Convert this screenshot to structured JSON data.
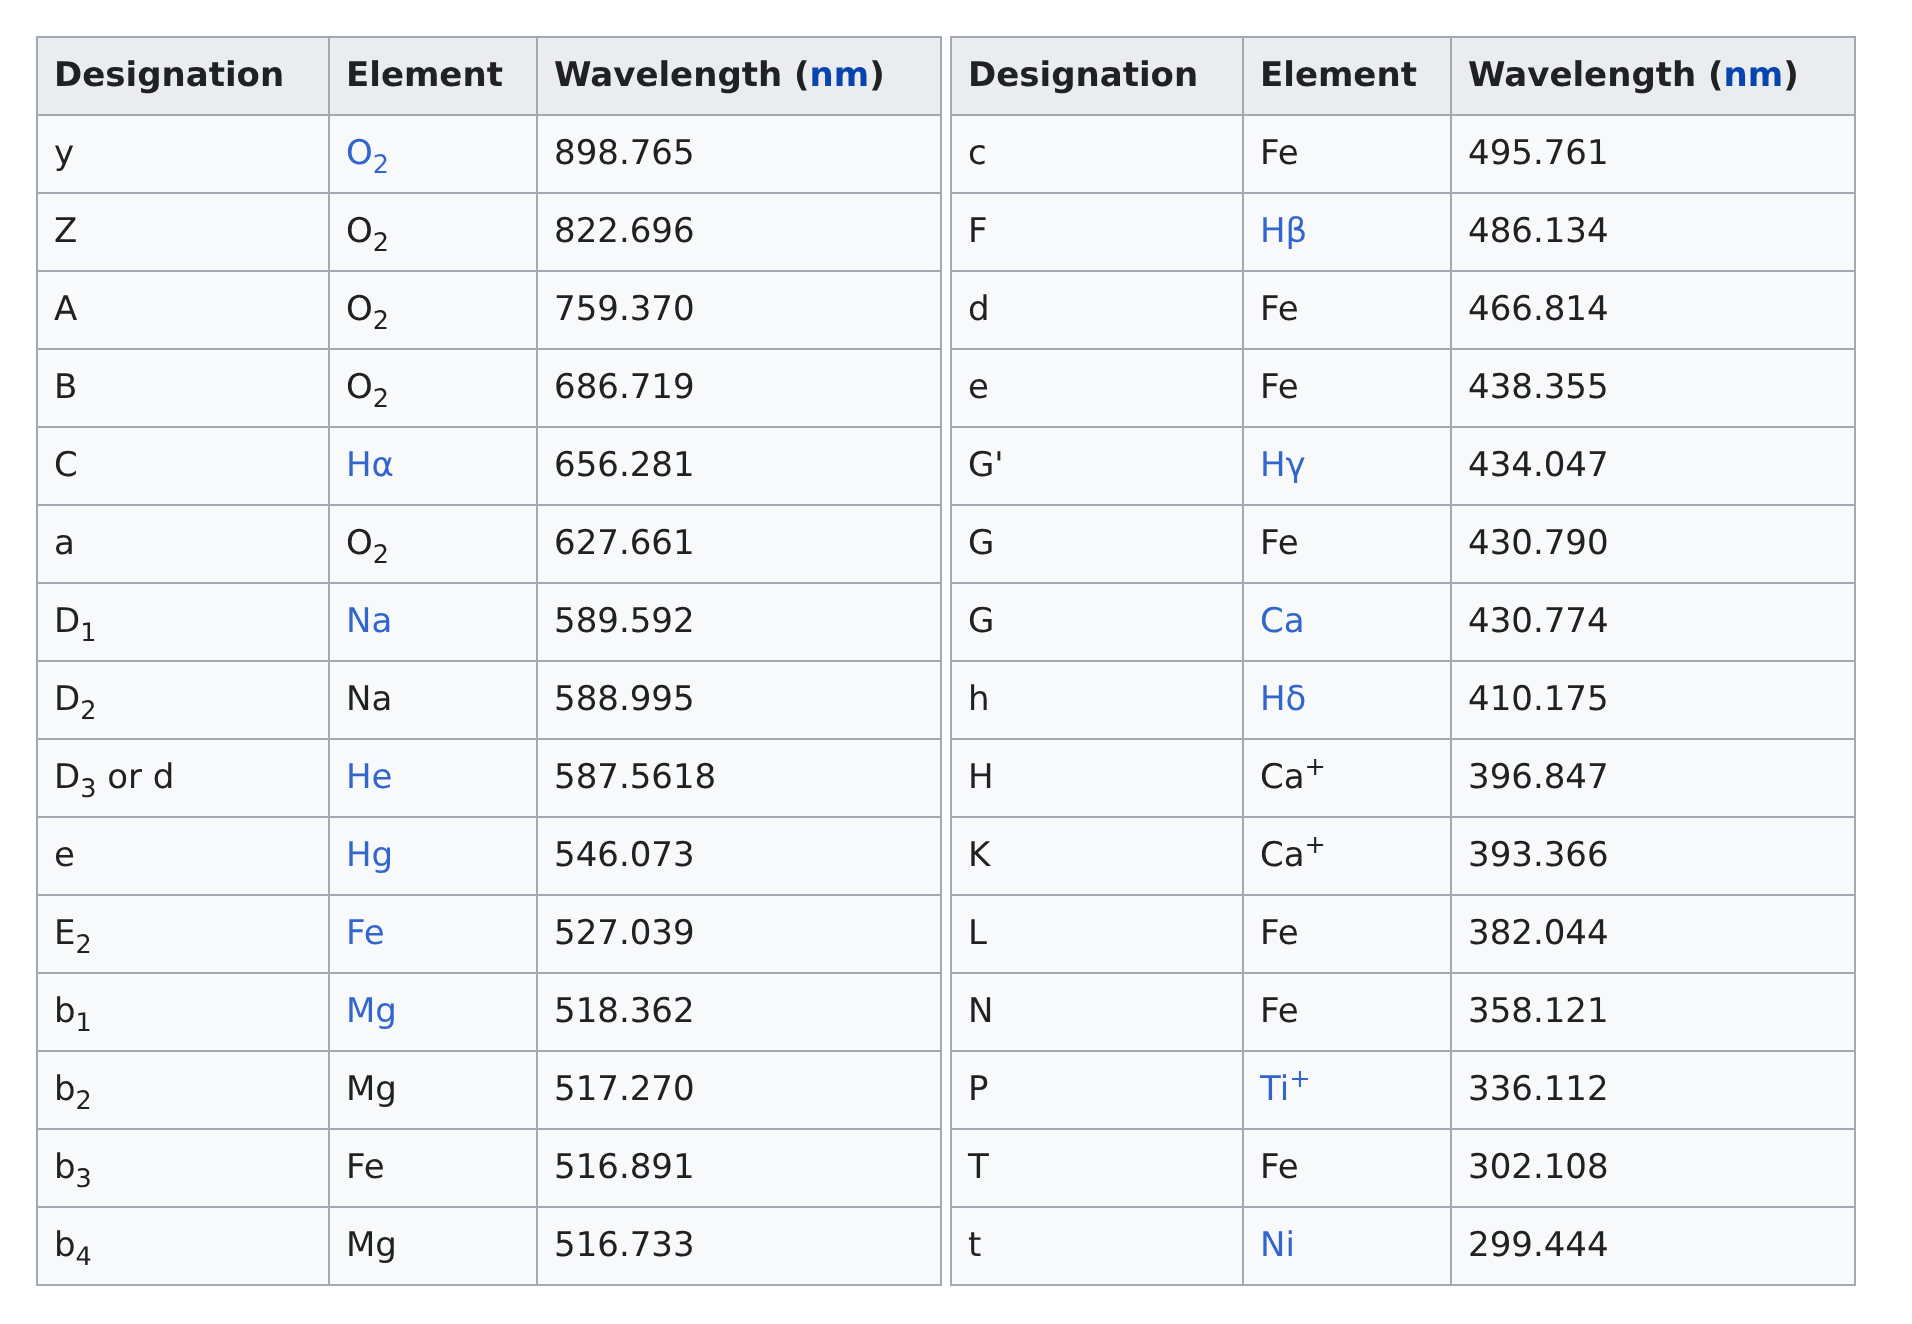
{
  "tables": [
    {
      "columns": [
        {
          "label": "Designation"
        },
        {
          "label": "Element"
        },
        {
          "label": "Wavelength (",
          "link": "nm",
          "suffix": ")"
        }
      ],
      "rows": [
        {
          "designation": "y",
          "element": "O$_{2}$",
          "element_linked": true,
          "wavelength": "898.765"
        },
        {
          "designation": "Z",
          "element": "O$_{2}$",
          "element_linked": false,
          "wavelength": "822.696"
        },
        {
          "designation": "A",
          "element": "O$_{2}$",
          "element_linked": false,
          "wavelength": "759.370"
        },
        {
          "designation": "B",
          "element": "O$_{2}$",
          "element_linked": false,
          "wavelength": "686.719"
        },
        {
          "designation": "C",
          "element": "Hα",
          "element_linked": true,
          "wavelength": "656.281"
        },
        {
          "designation": "a",
          "element": "O$_{2}$",
          "element_linked": false,
          "wavelength": "627.661"
        },
        {
          "designation": "D$_{1}$",
          "element": "Na",
          "element_linked": true,
          "wavelength": "589.592"
        },
        {
          "designation": "D$_{2}$",
          "element": "Na",
          "element_linked": false,
          "wavelength": "588.995"
        },
        {
          "designation": "D$_{3}$ or d",
          "element": "He",
          "element_linked": true,
          "wavelength": "587.5618"
        },
        {
          "designation": "e",
          "element": "Hg",
          "element_linked": true,
          "wavelength": "546.073"
        },
        {
          "designation": "E$_{2}$",
          "element": "Fe",
          "element_linked": true,
          "wavelength": "527.039"
        },
        {
          "designation": "b$_{1}$",
          "element": "Mg",
          "element_linked": true,
          "wavelength": "518.362"
        },
        {
          "designation": "b$_{2}$",
          "element": "Mg",
          "element_linked": false,
          "wavelength": "517.270"
        },
        {
          "designation": "b$_{3}$",
          "element": "Fe",
          "element_linked": false,
          "wavelength": "516.891"
        },
        {
          "designation": "b$_{4}$",
          "element": "Mg",
          "element_linked": false,
          "wavelength": "516.733"
        }
      ]
    },
    {
      "columns": [
        {
          "label": "Designation"
        },
        {
          "label": "Element"
        },
        {
          "label": "Wavelength (",
          "link": "nm",
          "suffix": ")"
        }
      ],
      "rows": [
        {
          "designation": "c",
          "element": "Fe",
          "element_linked": false,
          "wavelength": "495.761"
        },
        {
          "designation": "F",
          "element": "Hβ",
          "element_linked": true,
          "wavelength": "486.134"
        },
        {
          "designation": "d",
          "element": "Fe",
          "element_linked": false,
          "wavelength": "466.814"
        },
        {
          "designation": "e",
          "element": "Fe",
          "element_linked": false,
          "wavelength": "438.355"
        },
        {
          "designation": "G'",
          "element": "Hγ",
          "element_linked": true,
          "wavelength": "434.047"
        },
        {
          "designation": "G",
          "element": "Fe",
          "element_linked": false,
          "wavelength": "430.790"
        },
        {
          "designation": "G",
          "element": "Ca",
          "element_linked": true,
          "wavelength": "430.774"
        },
        {
          "designation": "h",
          "element": "Hδ",
          "element_linked": true,
          "wavelength": "410.175"
        },
        {
          "designation": "H",
          "element": "Ca$^{+}$",
          "element_linked": false,
          "wavelength": "396.847"
        },
        {
          "designation": "K",
          "element": "Ca$^{+}$",
          "element_linked": false,
          "wavelength": "393.366"
        },
        {
          "designation": "L",
          "element": "Fe",
          "element_linked": false,
          "wavelength": "382.044"
        },
        {
          "designation": "N",
          "element": "Fe",
          "element_linked": false,
          "wavelength": "358.121"
        },
        {
          "designation": "P",
          "element": "Ti$^{+}$",
          "element_linked": true,
          "wavelength": "336.112"
        },
        {
          "designation": "T",
          "element": "Fe",
          "element_linked": false,
          "wavelength": "302.108"
        },
        {
          "designation": "t",
          "element": "Ni",
          "element_linked": true,
          "wavelength": "299.444"
        }
      ]
    }
  ]
}
